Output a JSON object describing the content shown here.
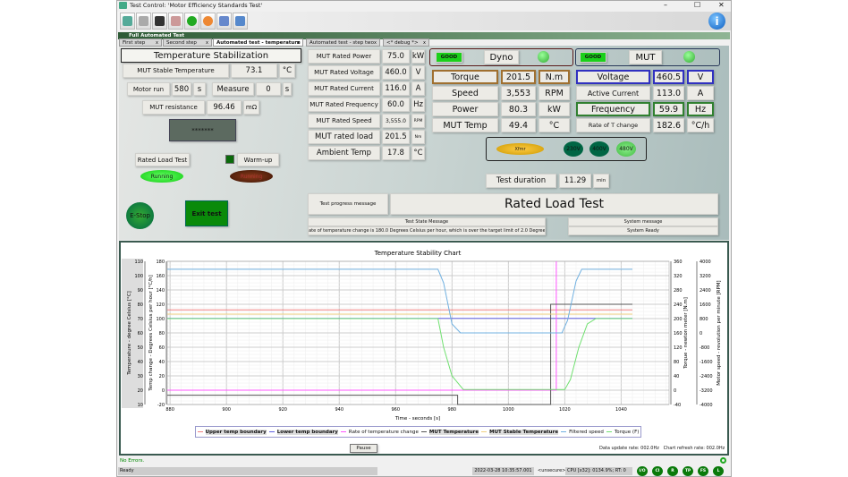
{
  "window": {
    "title": "Test Control: 'Motor Efficiency Standards Test'",
    "minimize": "–",
    "maximize": "☐",
    "close": "✕"
  },
  "toolbar": {
    "icons": [
      "exit-icon",
      "hand-icon",
      "printer-icon",
      "delete-icon",
      "refresh-icon",
      "record-icon",
      "network-icon",
      "windows-icon"
    ],
    "info_icon": "i"
  },
  "panel_title": "Full Automated Test",
  "tabs": [
    {
      "label": "First step"
    },
    {
      "label": "Second step"
    },
    {
      "label": "Automated test - temperature",
      "active": true
    },
    {
      "label": "Automated test - step two"
    },
    {
      "label": "<* debug *>"
    }
  ],
  "left": {
    "title": "Temperature Stabilization",
    "stable_temp": {
      "label": "MUT Stable Temperature",
      "value": "73.1",
      "unit": "°C"
    },
    "motor_run": {
      "label": "Motor run",
      "value": "580",
      "unit": "s"
    },
    "measure": {
      "label": "Measure",
      "value": "0",
      "unit": "s"
    },
    "resistance": {
      "label": "MUT resistance",
      "value": "96.46",
      "unit": "mΩ"
    },
    "password": "*******",
    "rated_load_test": "Rated Load Test",
    "warm_up": "Warm-up",
    "running1": "Running",
    "running2": "Running",
    "estop": "E-Stop",
    "exit": "Exit test"
  },
  "rated": [
    {
      "label": "MUT Rated Power",
      "value": "75.0",
      "unit": "kW"
    },
    {
      "label": "MUT Rated Voltage",
      "value": "460.0",
      "unit": "V"
    },
    {
      "label": "MUT Rated Current",
      "value": "116.0",
      "unit": "A"
    },
    {
      "label": "MUT Rated Frequency",
      "value": "60.0",
      "unit": "Hz"
    },
    {
      "label": "MUT Rated Speed",
      "value": "3,555.0",
      "unit": "RPM"
    },
    {
      "label": "MUT rated load",
      "value": "201.5",
      "unit": "Nm"
    },
    {
      "label": "Ambient Temp",
      "value": "17.8",
      "unit": "°C"
    }
  ],
  "dyno": {
    "status": "GOOD",
    "name": "Dyno",
    "rows": [
      {
        "label": "Torque",
        "value": "201.5",
        "unit": "N.m"
      },
      {
        "label": "Speed",
        "value": "3,553",
        "unit": "RPM"
      },
      {
        "label": "Power",
        "value": "80.3",
        "unit": "kW"
      },
      {
        "label": "MUT Temp",
        "value": "49.4",
        "unit": "°C"
      }
    ]
  },
  "mut": {
    "status": "GOOD",
    "name": "MUT",
    "rows": [
      {
        "label": "Voltage",
        "value": "460.5",
        "unit": "V"
      },
      {
        "label": "Active Current",
        "value": "113.0",
        "unit": "A"
      },
      {
        "label": "Frequency",
        "value": "59.9",
        "unit": "Hz"
      },
      {
        "label": "Rate of T change",
        "value": "182.6",
        "unit": "°C/h"
      }
    ]
  },
  "xfmr": {
    "label": "Xfmr",
    "v230": "230V",
    "v400": "400V",
    "v480": "480V"
  },
  "duration": {
    "label": "Test duration",
    "value": "11.29",
    "unit": "min"
  },
  "progress": {
    "label": "Test progress message",
    "value": "Rated Load Test"
  },
  "state": {
    "label": "Test State Message",
    "value": "Rate of temperature change is 180.0 Degrees Celsius per hour, which is over the target limit of 2.0 Degrees"
  },
  "system": {
    "label": "System message",
    "value": "System Ready"
  },
  "pause": "Pause",
  "rates": "Data update rate: 002.0Hz   Chart refresh rate: 002.0Hz",
  "errors": "No Errors.",
  "status": {
    "ready": "Ready",
    "datetime": "2022-03-28 10:35:57.001",
    "security": "<unsecure>",
    "cpu": "CPU [x32]: 0134.9%; RT: 0",
    "indicators": [
      "I/O",
      "CI",
      "R",
      "TP",
      "FS",
      "L"
    ]
  },
  "chart_data": {
    "type": "line",
    "title": "Temperature Stability Chart",
    "xlabel": "Time - seconds [s]",
    "xlim": [
      879,
      1057
    ],
    "xticks": [
      880,
      900,
      920,
      940,
      960,
      980,
      1000,
      1020,
      1040
    ],
    "axes": {
      "temp": {
        "label": "Temperature - degree Celsius [°C]",
        "lim": [
          10,
          110
        ],
        "ticks": [
          10,
          20,
          30,
          40,
          50,
          60,
          70,
          80,
          90,
          100,
          110
        ]
      },
      "rate": {
        "label": "Temp change - Degrees Celsius per hour [°C/h]",
        "lim": [
          -20,
          180
        ],
        "ticks": [
          -20,
          0,
          20,
          40,
          60,
          80,
          100,
          120,
          140,
          160,
          180
        ]
      },
      "torque": {
        "label": "Torque - newton meter [N.m]",
        "lim": [
          -40,
          360
        ],
        "ticks": [
          -40,
          0,
          40,
          80,
          120,
          160,
          200,
          240,
          280,
          320,
          360
        ]
      },
      "speed": {
        "label": "Motor speed - revolution per minute [RPM]",
        "lim": [
          -4000,
          4000
        ],
        "ticks": [
          -4000,
          -3200,
          -2400,
          -1600,
          -800,
          0,
          800,
          1600,
          2400,
          3200,
          4000
        ]
      }
    },
    "grid": true,
    "legend": "bottom",
    "series": [
      {
        "name": "Upper temp boundary",
        "axis": "temp",
        "color": "#f08080",
        "x": [
          879,
          1044
        ],
        "y": [
          76.1,
          76.1
        ]
      },
      {
        "name": "Lower temp boundary",
        "axis": "temp",
        "color": "#6060e0",
        "x": [
          879,
          1044
        ],
        "y": [
          70.1,
          70.1
        ]
      },
      {
        "name": "Rate of temperature change",
        "axis": "rate",
        "color": "#ff55ff",
        "x": [
          879,
          1017,
          1017
        ],
        "y": [
          0,
          0,
          180
        ]
      },
      {
        "name": "MUT Temperature",
        "axis": "temp",
        "color": "#555555",
        "x": [
          879,
          982,
          982,
          1015,
          1015,
          1044
        ],
        "y": [
          16.5,
          16.5,
          10,
          10,
          80,
          80
        ]
      },
      {
        "name": "MUT Stable Temperature",
        "axis": "temp",
        "color": "#f0d080",
        "x": [
          879,
          1044
        ],
        "y": [
          73.1,
          73.1
        ]
      },
      {
        "name": "Filtered speed",
        "axis": "speed",
        "color": "#70b0e0",
        "x": [
          879,
          975,
          977,
          980,
          983,
          1019,
          1021,
          1024,
          1026,
          1044
        ],
        "y": [
          3553,
          3553,
          2800,
          500,
          0,
          0,
          700,
          2900,
          3553,
          3553
        ]
      },
      {
        "name": "Torque (F)",
        "axis": "torque",
        "color": "#70e070",
        "x": [
          879,
          975,
          977,
          980,
          984,
          1020,
          1022,
          1025,
          1028,
          1031,
          1044
        ],
        "y": [
          200,
          200,
          120,
          40,
          2,
          2,
          30,
          120,
          185,
          200,
          200
        ]
      }
    ]
  }
}
